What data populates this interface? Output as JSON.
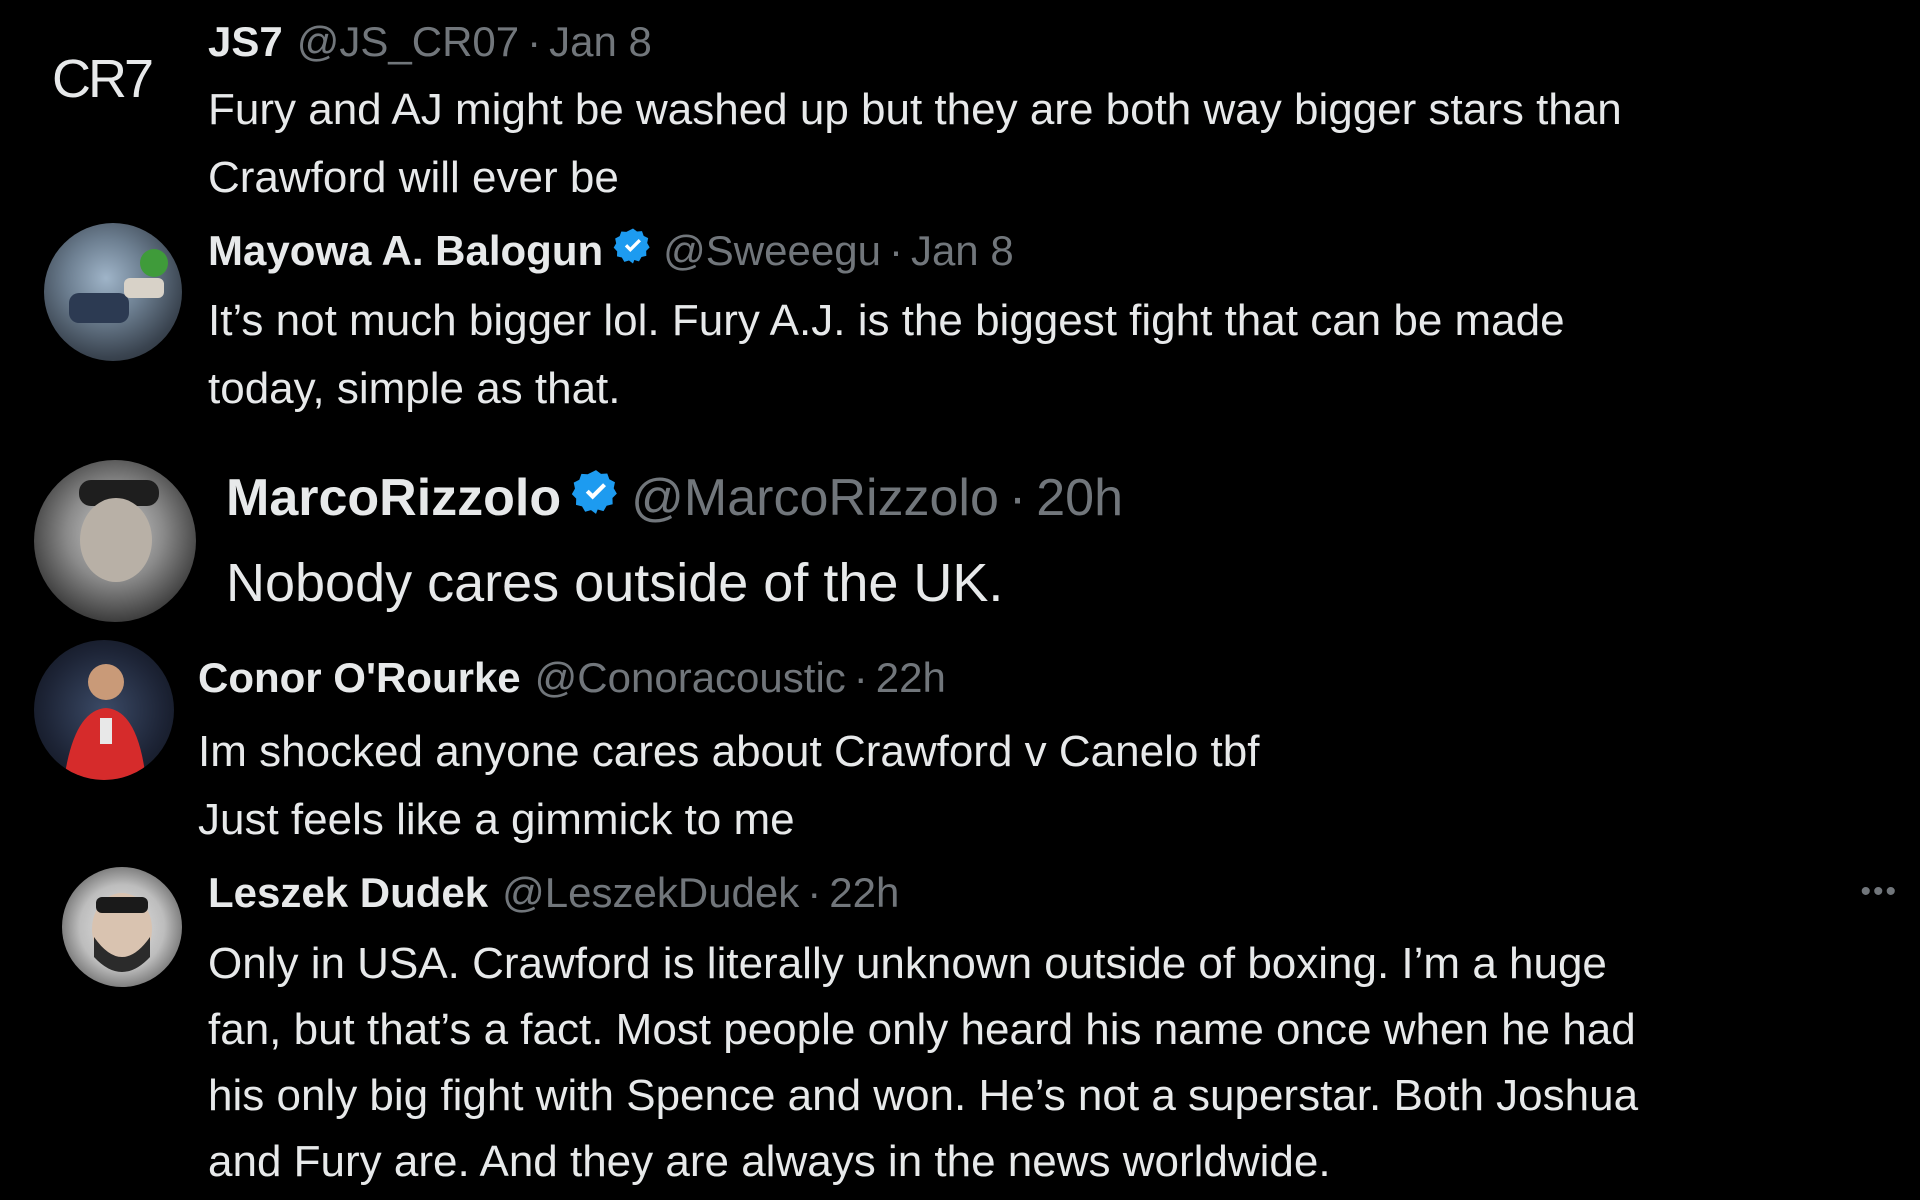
{
  "tweets": [
    {
      "avatar_text": "CR7",
      "name": "JS7",
      "handle": "@JS_CR07",
      "sep": "·",
      "time": "Jan 8",
      "verified": false,
      "text": "Fury and AJ might be washed up but they are both way bigger stars than\nCrawford will ever be"
    },
    {
      "name": "Mayowa A. Balogun",
      "handle": "@Sweeegu",
      "sep": "·",
      "time": "Jan 8",
      "verified": true,
      "text": "It’s not much bigger lol. Fury A.J. is the biggest fight that can be made\ntoday, simple as that."
    },
    {
      "name": "MarcoRizzolo",
      "handle": "@MarcoRizzolo",
      "sep": "·",
      "time": "20h",
      "verified": true,
      "text": "Nobody cares outside of the UK."
    },
    {
      "name": "Conor O'Rourke",
      "handle": "@Conoracoustic",
      "sep": "·",
      "time": "22h",
      "verified": false,
      "text": "Im shocked anyone cares about Crawford v Canelo tbf\nJust feels like a gimmick to me"
    },
    {
      "name": "Leszek Dudek",
      "handle": "@LeszekDudek",
      "sep": "·",
      "time": "22h",
      "verified": false,
      "text": "Only in USA. Crawford is literally unknown outside of boxing. I’m a huge\nfan, but that’s a fact. Most people only heard his name once when he had\nhis only big fight with Spence and won. He’s not a superstar. Both Joshua\nand Fury are. And they are always in the news worldwide."
    }
  ],
  "more_label": "•••",
  "colors": {
    "background": "#000000",
    "text": "#e7e9ea",
    "muted": "#71767b",
    "verified": "#1d9bf0"
  }
}
